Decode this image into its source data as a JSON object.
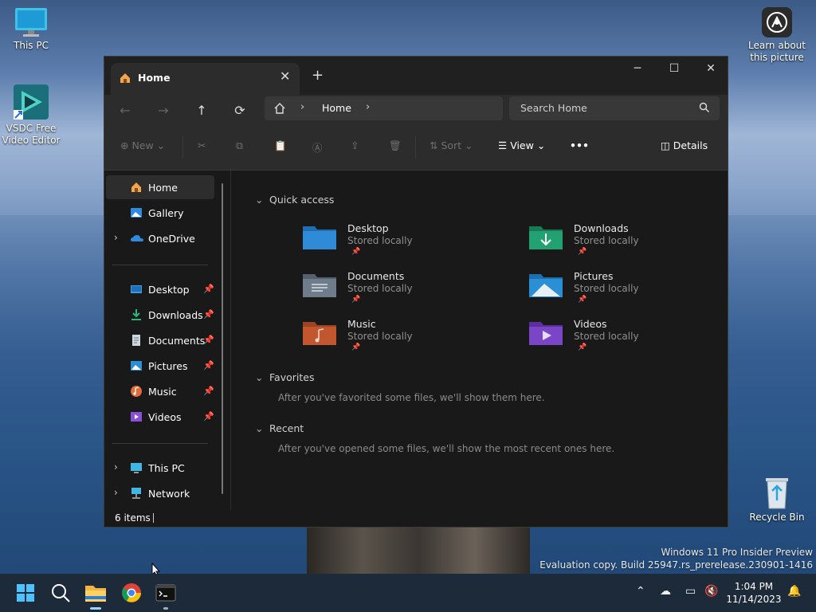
{
  "desktop": {
    "icons": [
      {
        "label": "This PC",
        "icon": "monitor-icon"
      },
      {
        "label": "VSDC Free Video Editor",
        "icon": "vsdc-icon"
      },
      {
        "label": "Learn about this picture",
        "icon": "camera-icon"
      },
      {
        "label": "Recycle Bin",
        "icon": "recycle-bin-icon"
      }
    ],
    "watermark": {
      "line1": "Windows 11 Pro Insider Preview",
      "line2": "Evaluation copy. Build 25947.rs_prerelease.230901-1416"
    }
  },
  "explorer": {
    "tab_title": "Home",
    "address": {
      "home_icon": "home-icon",
      "crumb": "Home"
    },
    "search": {
      "placeholder": "Search Home"
    },
    "commands": {
      "new": "New",
      "sort": "Sort",
      "view": "View",
      "more": "•••",
      "details": "Details"
    },
    "sidebar": {
      "top": [
        {
          "label": "Home",
          "icon": "home-icon",
          "selected": true
        },
        {
          "label": "Gallery",
          "icon": "gallery-icon"
        },
        {
          "label": "OneDrive",
          "icon": "onedrive-icon",
          "expandable": true
        }
      ],
      "pinned": [
        {
          "label": "Desktop",
          "icon": "desktop-folder-icon"
        },
        {
          "label": "Downloads",
          "icon": "downloads-icon"
        },
        {
          "label": "Documents",
          "icon": "documents-icon"
        },
        {
          "label": "Pictures",
          "icon": "pictures-icon"
        },
        {
          "label": "Music",
          "icon": "music-icon"
        },
        {
          "label": "Videos",
          "icon": "videos-icon"
        }
      ],
      "bottom": [
        {
          "label": "This PC",
          "icon": "this-pc-icon"
        },
        {
          "label": "Network",
          "icon": "network-icon"
        }
      ]
    },
    "content": {
      "quick_access_header": "Quick access",
      "quick_access": [
        {
          "name": "Desktop",
          "status": "Stored locally",
          "color": "#2f7fc1"
        },
        {
          "name": "Downloads",
          "status": "Stored locally",
          "color": "#1f9a6e"
        },
        {
          "name": "Documents",
          "status": "Stored locally",
          "color": "#6a7a8c"
        },
        {
          "name": "Pictures",
          "status": "Stored locally",
          "color": "#2b8fd6"
        },
        {
          "name": "Music",
          "status": "Stored locally",
          "color": "#c2572f"
        },
        {
          "name": "Videos",
          "status": "Stored locally",
          "color": "#7a45c6"
        }
      ],
      "favorites_header": "Favorites",
      "favorites_msg": "After you've favorited some files, we'll show them here.",
      "recent_header": "Recent",
      "recent_msg": "After you've opened some files, we'll show the most recent ones here."
    },
    "status": {
      "items": "6 items"
    }
  },
  "taskbar": {
    "clock_time": "1:04 PM",
    "clock_date": "11/14/2023"
  }
}
